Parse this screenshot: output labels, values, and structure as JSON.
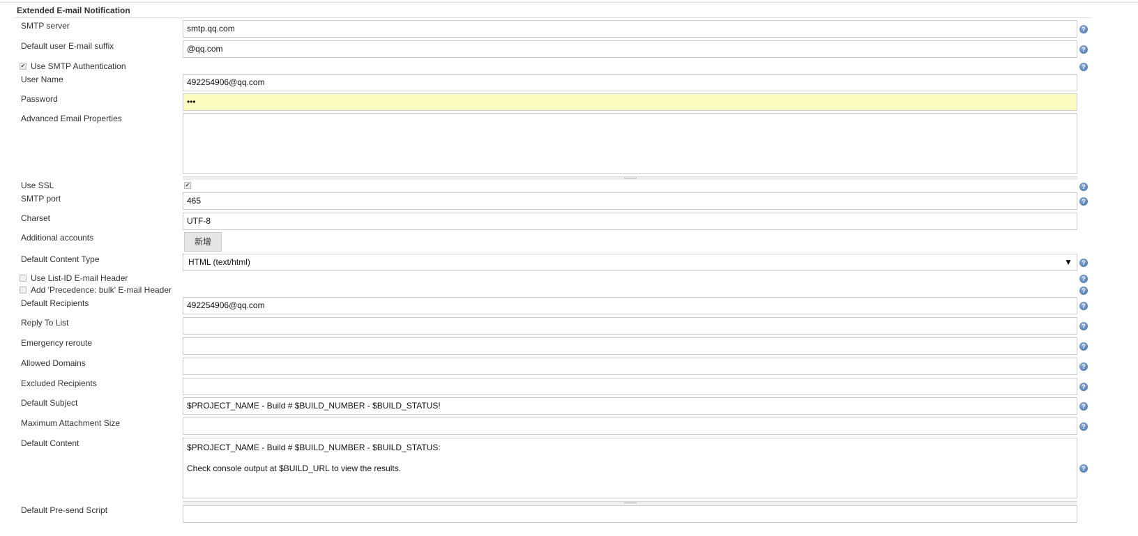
{
  "section_title": "Extended E-mail Notification",
  "rows": [
    {
      "type": "input",
      "label": "SMTP server",
      "value": "smtp.qq.com",
      "help": true
    },
    {
      "type": "input",
      "label": "Default user E-mail suffix",
      "value": "@qq.com",
      "help": true
    },
    {
      "type": "checkbox",
      "label": "Use SMTP Authentication",
      "checked": true,
      "help": true
    },
    {
      "type": "input",
      "label": "User Name",
      "value": "492254906@qq.com",
      "help": false
    },
    {
      "type": "password",
      "label": "Password",
      "value": "•••",
      "help": false
    },
    {
      "type": "textarea",
      "label": "Advanced Email Properties",
      "value": "",
      "help": false
    },
    {
      "type": "inline-checkbox",
      "label": "Use SSL",
      "checked": true,
      "help": true
    },
    {
      "type": "input",
      "label": "SMTP port",
      "value": "465",
      "help": true
    },
    {
      "type": "input",
      "label": "Charset",
      "value": "UTF-8",
      "help": false
    },
    {
      "type": "button",
      "label": "Additional accounts",
      "value": "新增",
      "help": false
    },
    {
      "type": "select",
      "label": "Default Content Type",
      "value": "HTML (text/html)",
      "help": true
    },
    {
      "type": "checkbox",
      "label": "Use List-ID E-mail Header",
      "checked": false,
      "help": true
    },
    {
      "type": "checkbox",
      "label": "Add 'Precedence: bulk' E-mail Header",
      "checked": false,
      "help": true
    },
    {
      "type": "input",
      "label": "Default Recipients",
      "value": "492254906@qq.com",
      "help": true
    },
    {
      "type": "input",
      "label": "Reply To List",
      "value": "",
      "help": true
    },
    {
      "type": "input",
      "label": "Emergency reroute",
      "value": "",
      "help": true
    },
    {
      "type": "input",
      "label": "Allowed Domains",
      "value": "",
      "help": true
    },
    {
      "type": "input",
      "label": "Excluded Recipients",
      "value": "",
      "help": true
    },
    {
      "type": "input",
      "label": "Default Subject",
      "value": "$PROJECT_NAME - Build # $BUILD_NUMBER - $BUILD_STATUS!",
      "help": true
    },
    {
      "type": "input",
      "label": "Maximum Attachment Size",
      "value": "",
      "help": true
    },
    {
      "type": "textarea",
      "label": "Default Content",
      "value": "$PROJECT_NAME - Build # $BUILD_NUMBER - $BUILD_STATUS:\n\nCheck console output at $BUILD_URL to view the results.",
      "help": true
    },
    {
      "type": "input",
      "label": "Default Pre-send Script",
      "value": "",
      "help": false
    }
  ],
  "colors": {
    "password_bg": "#fafcc0",
    "help": "#3d6aa8"
  }
}
